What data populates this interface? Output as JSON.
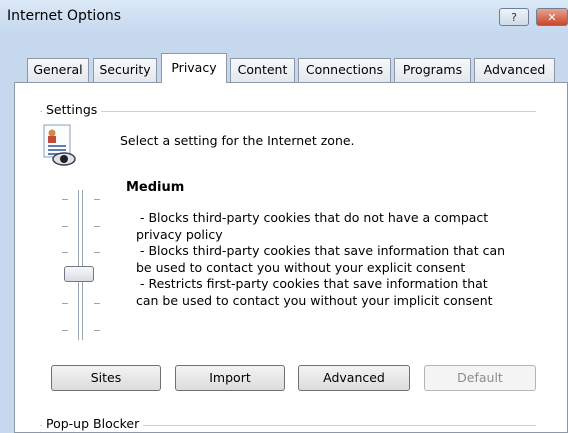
{
  "window": {
    "title": "Internet Options",
    "help_label": "?",
    "close_label": "✕"
  },
  "tabs": [
    {
      "label": "General"
    },
    {
      "label": "Security"
    },
    {
      "label": "Privacy",
      "active": true
    },
    {
      "label": "Content"
    },
    {
      "label": "Connections"
    },
    {
      "label": "Programs"
    },
    {
      "label": "Advanced"
    }
  ],
  "settings": {
    "group_label": "Settings",
    "zone_prompt": "Select a setting for the Internet zone.",
    "level_name": "Medium",
    "description_lines": [
      "- Blocks third-party cookies that do not have a compact",
      "privacy policy",
      "- Blocks third-party cookies that save information that can",
      "be used to contact you without your explicit consent",
      "- Restricts first-party cookies that save information that",
      "can be used to contact you without your implicit consent"
    ],
    "slider": {
      "level_index": 2,
      "levels": 6
    },
    "buttons": {
      "sites": "Sites",
      "import": "Import",
      "advanced": "Advanced",
      "default": "Default"
    }
  },
  "popup_blocker": {
    "group_label": "Pop-up Blocker"
  },
  "icons": {
    "zone_icon": "privacy-document-eye-icon"
  }
}
